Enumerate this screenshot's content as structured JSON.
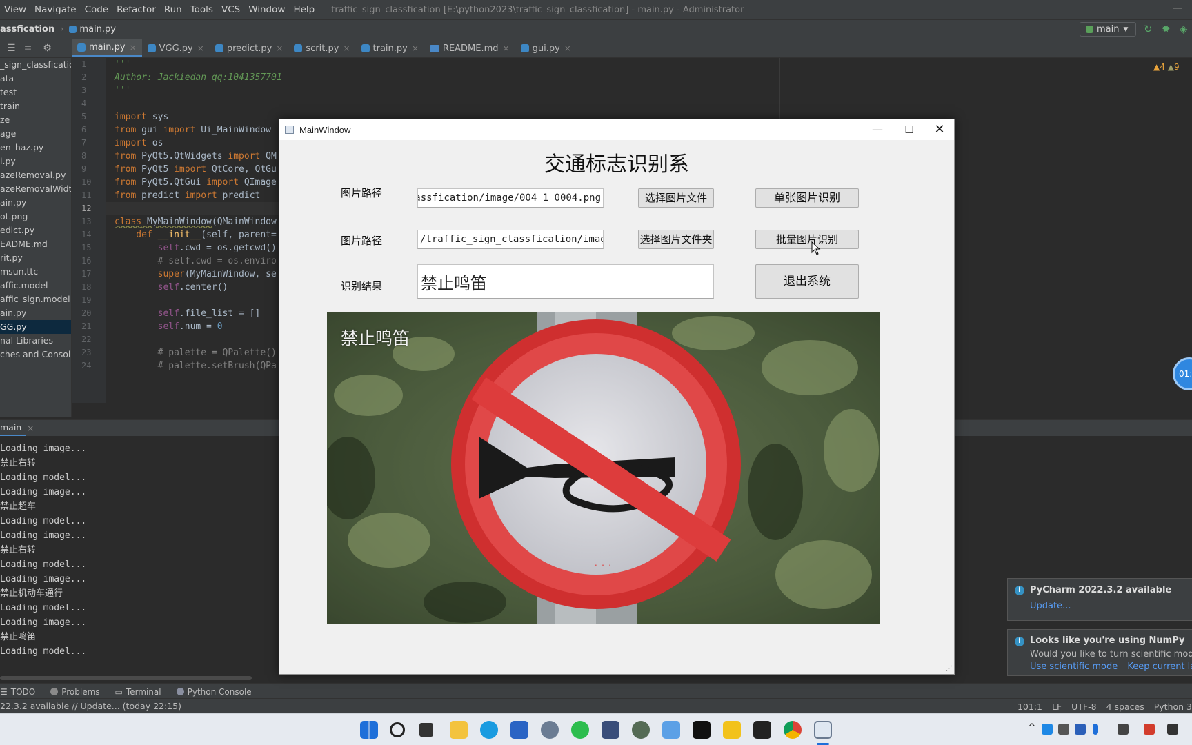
{
  "menubar": {
    "items": [
      "View",
      "Navigate",
      "Code",
      "Refactor",
      "Run",
      "Tools",
      "VCS",
      "Window",
      "Help"
    ],
    "window_title": "traffic_sign_classfication [E:\\python2023\\traffic_sign_classfication] - main.py - Administrator"
  },
  "navbar": {
    "project": "assfication",
    "file": "main.py",
    "run_config": "main"
  },
  "tabs": [
    {
      "label": "main.py",
      "active": true
    },
    {
      "label": "VGG.py"
    },
    {
      "label": "predict.py"
    },
    {
      "label": "scrit.py"
    },
    {
      "label": "train.py"
    },
    {
      "label": "README.md"
    },
    {
      "label": "gui.py"
    }
  ],
  "sidebar": {
    "items": [
      "_sign_classficatio",
      "ata",
      "test",
      "train",
      "ze",
      "age",
      "en_haz.py",
      "i.py",
      "azeRemoval.py",
      "azeRemovalWidth(",
      "ain.py",
      "ot.png",
      "edict.py",
      "EADME.md",
      "rit.py",
      "msun.ttc",
      "affic.model",
      "affic_sign.model",
      "ain.py",
      "GG.py",
      "nal Libraries",
      "ches and Consoles"
    ],
    "selected_index": 19
  },
  "editor": {
    "line_numbers": [
      "1",
      "2",
      "3",
      "4",
      "5",
      "6",
      "7",
      "8",
      "9",
      "10",
      "11",
      "12",
      "13",
      "14",
      "15",
      "16",
      "17",
      "18",
      "19",
      "20",
      "21",
      "22",
      "23",
      "24"
    ],
    "current_line": 12,
    "warnings": {
      "warn_count": "4",
      "weak_count": "9"
    }
  },
  "code": {
    "l1": "'''",
    "l2a": "Author: ",
    "l2b": "Jackiedan",
    "l2c": " qq:1041357701",
    "l3": "'''",
    "l5a": "import",
    "l5b": " sys",
    "l6a": "from",
    "l6b": " gui ",
    "l6c": "import",
    "l6d": " Ui_MainWindow",
    "l7a": "import",
    "l7b": " os",
    "l8a": "from",
    "l8b": " PyQt5.QtWidgets ",
    "l8c": "import",
    "l8d": " QM",
    "l9a": "from",
    "l9b": " PyQt5 ",
    "l9c": "import",
    "l9d": " QtCore, QtGu",
    "l10a": "from",
    "l10b": " PyQt5.QtGui ",
    "l10c": "import",
    "l10d": " QImage",
    "l11a": "from",
    "l11b": " predict ",
    "l11c": "import",
    "l11d": " predict",
    "l13a": "class",
    "l13b": " MyMainWindow",
    "l13c": "(QMainWindow",
    "l14a": "    def",
    "l14b": " __init__",
    "l14c": "(self, parent=",
    "l15a": "        self",
    "l15b": ".cwd = os.getcwd()",
    "l16": "        # self.cwd = os.enviro",
    "l17a": "        super",
    "l17b": "(MyMainWindow, se",
    "l18a": "        self",
    "l18b": ".center()",
    "l20a": "        self",
    "l20b": ".file_list = []",
    "l21a": "        self",
    "l21b": ".num = ",
    "l21c": "0",
    "l23": "        # palette = QPalette()",
    "l24": "        # palette.setBrush(QPa"
  },
  "run": {
    "tab": "main",
    "output": [
      "Loading image...",
      "禁止右转",
      "Loading model...",
      "Loading image...",
      "禁止超车",
      "Loading model...",
      "Loading image...",
      "禁止右转",
      "Loading model...",
      "Loading image...",
      "禁止机动车通行",
      "Loading model...",
      "Loading image...",
      "禁止鸣笛",
      "Loading model..."
    ]
  },
  "tools": [
    "TODO",
    "Problems",
    "Terminal",
    "Python Console"
  ],
  "status": {
    "left": "22.3.2 available // Update... (today 22:15)",
    "position": "101:1",
    "line_sep": "LF",
    "encoding": "UTF-8",
    "indent": "4 spaces",
    "interpreter": "Python 3"
  },
  "notifications": [
    {
      "title": "PyCharm 2022.3.2 available",
      "link": "Update..."
    },
    {
      "title": "Looks like you're using NumPy",
      "body": "Would you like to turn scientific mode on",
      "link1": "Use scientific mode",
      "link2": "Keep current layout"
    }
  ],
  "timer_badge": "01:5",
  "app": {
    "window_title": "MainWindow",
    "heading": "交通标志识别系",
    "label_path1": "图片路径",
    "path1_value": "lassfication/image/004_1_0004.png",
    "btn_select_file": "选择图片文件",
    "btn_single": "单张图片识别",
    "label_path2": "图片路径",
    "path2_value": "/traffic_sign_classfication/image",
    "btn_select_folder": "选择图片文件夹",
    "btn_batch": "批量图片识别",
    "label_result": "识别结果",
    "result_value": "禁止鸣笛",
    "btn_exit": "退出系统",
    "image_overlay": "禁止鸣笛"
  }
}
